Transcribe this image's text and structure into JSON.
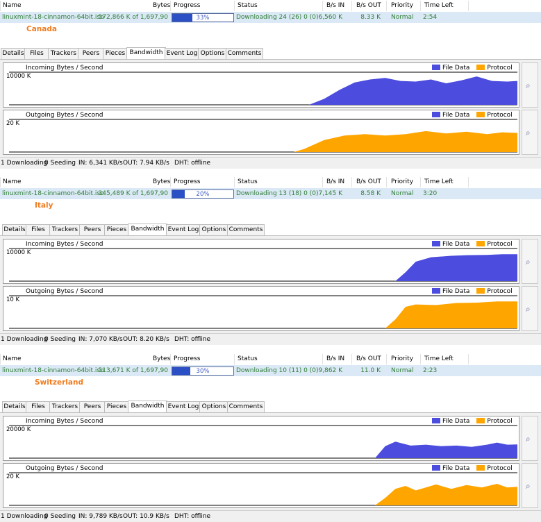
{
  "colors": {
    "file_data": "#4c4cdf",
    "protocol": "#ffa500",
    "country": "#f07c1f",
    "row_text": "#2e7d32"
  },
  "columns": [
    "Name",
    "Bytes",
    "Progress",
    "Status",
    "B/s IN",
    "B/s OUT",
    "Priority",
    "Time Left"
  ],
  "tabs": [
    "Details",
    "Files",
    "Trackers",
    "Peers",
    "Pieces",
    "Bandwidth",
    "Event Log",
    "Options",
    "Comments"
  ],
  "active_tab": "Bandwidth",
  "graph_titles": {
    "incoming": "Incoming Bytes / Second",
    "outgoing": "Outgoing Bytes / Second"
  },
  "legend": {
    "file_data": "File Data",
    "protocol": "Protocol"
  },
  "zoom_icon": "zoom-magnifier-icon",
  "panels": [
    {
      "country": "Canada",
      "torrent": {
        "name": "linuxmint-18-cinnamon-64bit.iso",
        "bytes": "572,866 K of 1,697,90",
        "progress_text": "33%",
        "progress": 0.33,
        "status": "Downloading 24 (26) 0 (0)",
        "in": "6,560 K",
        "out": "8.33 K",
        "priority": "Normal",
        "time_left": "2:54"
      },
      "incoming_scale": "10000 K",
      "outgoing_scale": "20 K",
      "statusbar": {
        "downloading": "1 Downloading",
        "seeding": "0 Seeding",
        "in": "IN: 6,341 KB/s",
        "out": "OUT: 7.94 KB/s",
        "dht": "DHT: offline"
      }
    },
    {
      "country": "Italy",
      "torrent": {
        "name": "linuxmint-18-cinnamon-64bit.iso",
        "bytes": "345,489 K of 1,697,90",
        "progress_text": "20%",
        "progress": 0.2,
        "status": "Downloading 13 (18) 0 (0)",
        "in": "7,145 K",
        "out": "8.58 K",
        "priority": "Normal",
        "time_left": "3:20"
      },
      "incoming_scale": "10000 K",
      "outgoing_scale": "10 K",
      "statusbar": {
        "downloading": "1 Downloading",
        "seeding": "0 Seeding",
        "in": "IN: 7,070 KB/s",
        "out": "OUT: 8.20 KB/s",
        "dht": "DHT: offline"
      }
    },
    {
      "country": "Switzerland",
      "torrent": {
        "name": "linuxmint-18-cinnamon-64bit.iso",
        "bytes": "513,671 K of 1,697,90",
        "progress_text": "30%",
        "progress": 0.3,
        "status": "Downloading 10 (11) 0 (0)",
        "in": "9,862 K",
        "out": "11.0 K",
        "priority": "Normal",
        "time_left": "2:23"
      },
      "incoming_scale": "20000 K",
      "outgoing_scale": "20 K",
      "statusbar": {
        "downloading": "1 Downloading",
        "seeding": "0 Seeding",
        "in": "IN: 9,789 KB/s",
        "out": "OUT: 10.9 KB/s",
        "dht": "DHT: offline"
      }
    }
  ]
}
